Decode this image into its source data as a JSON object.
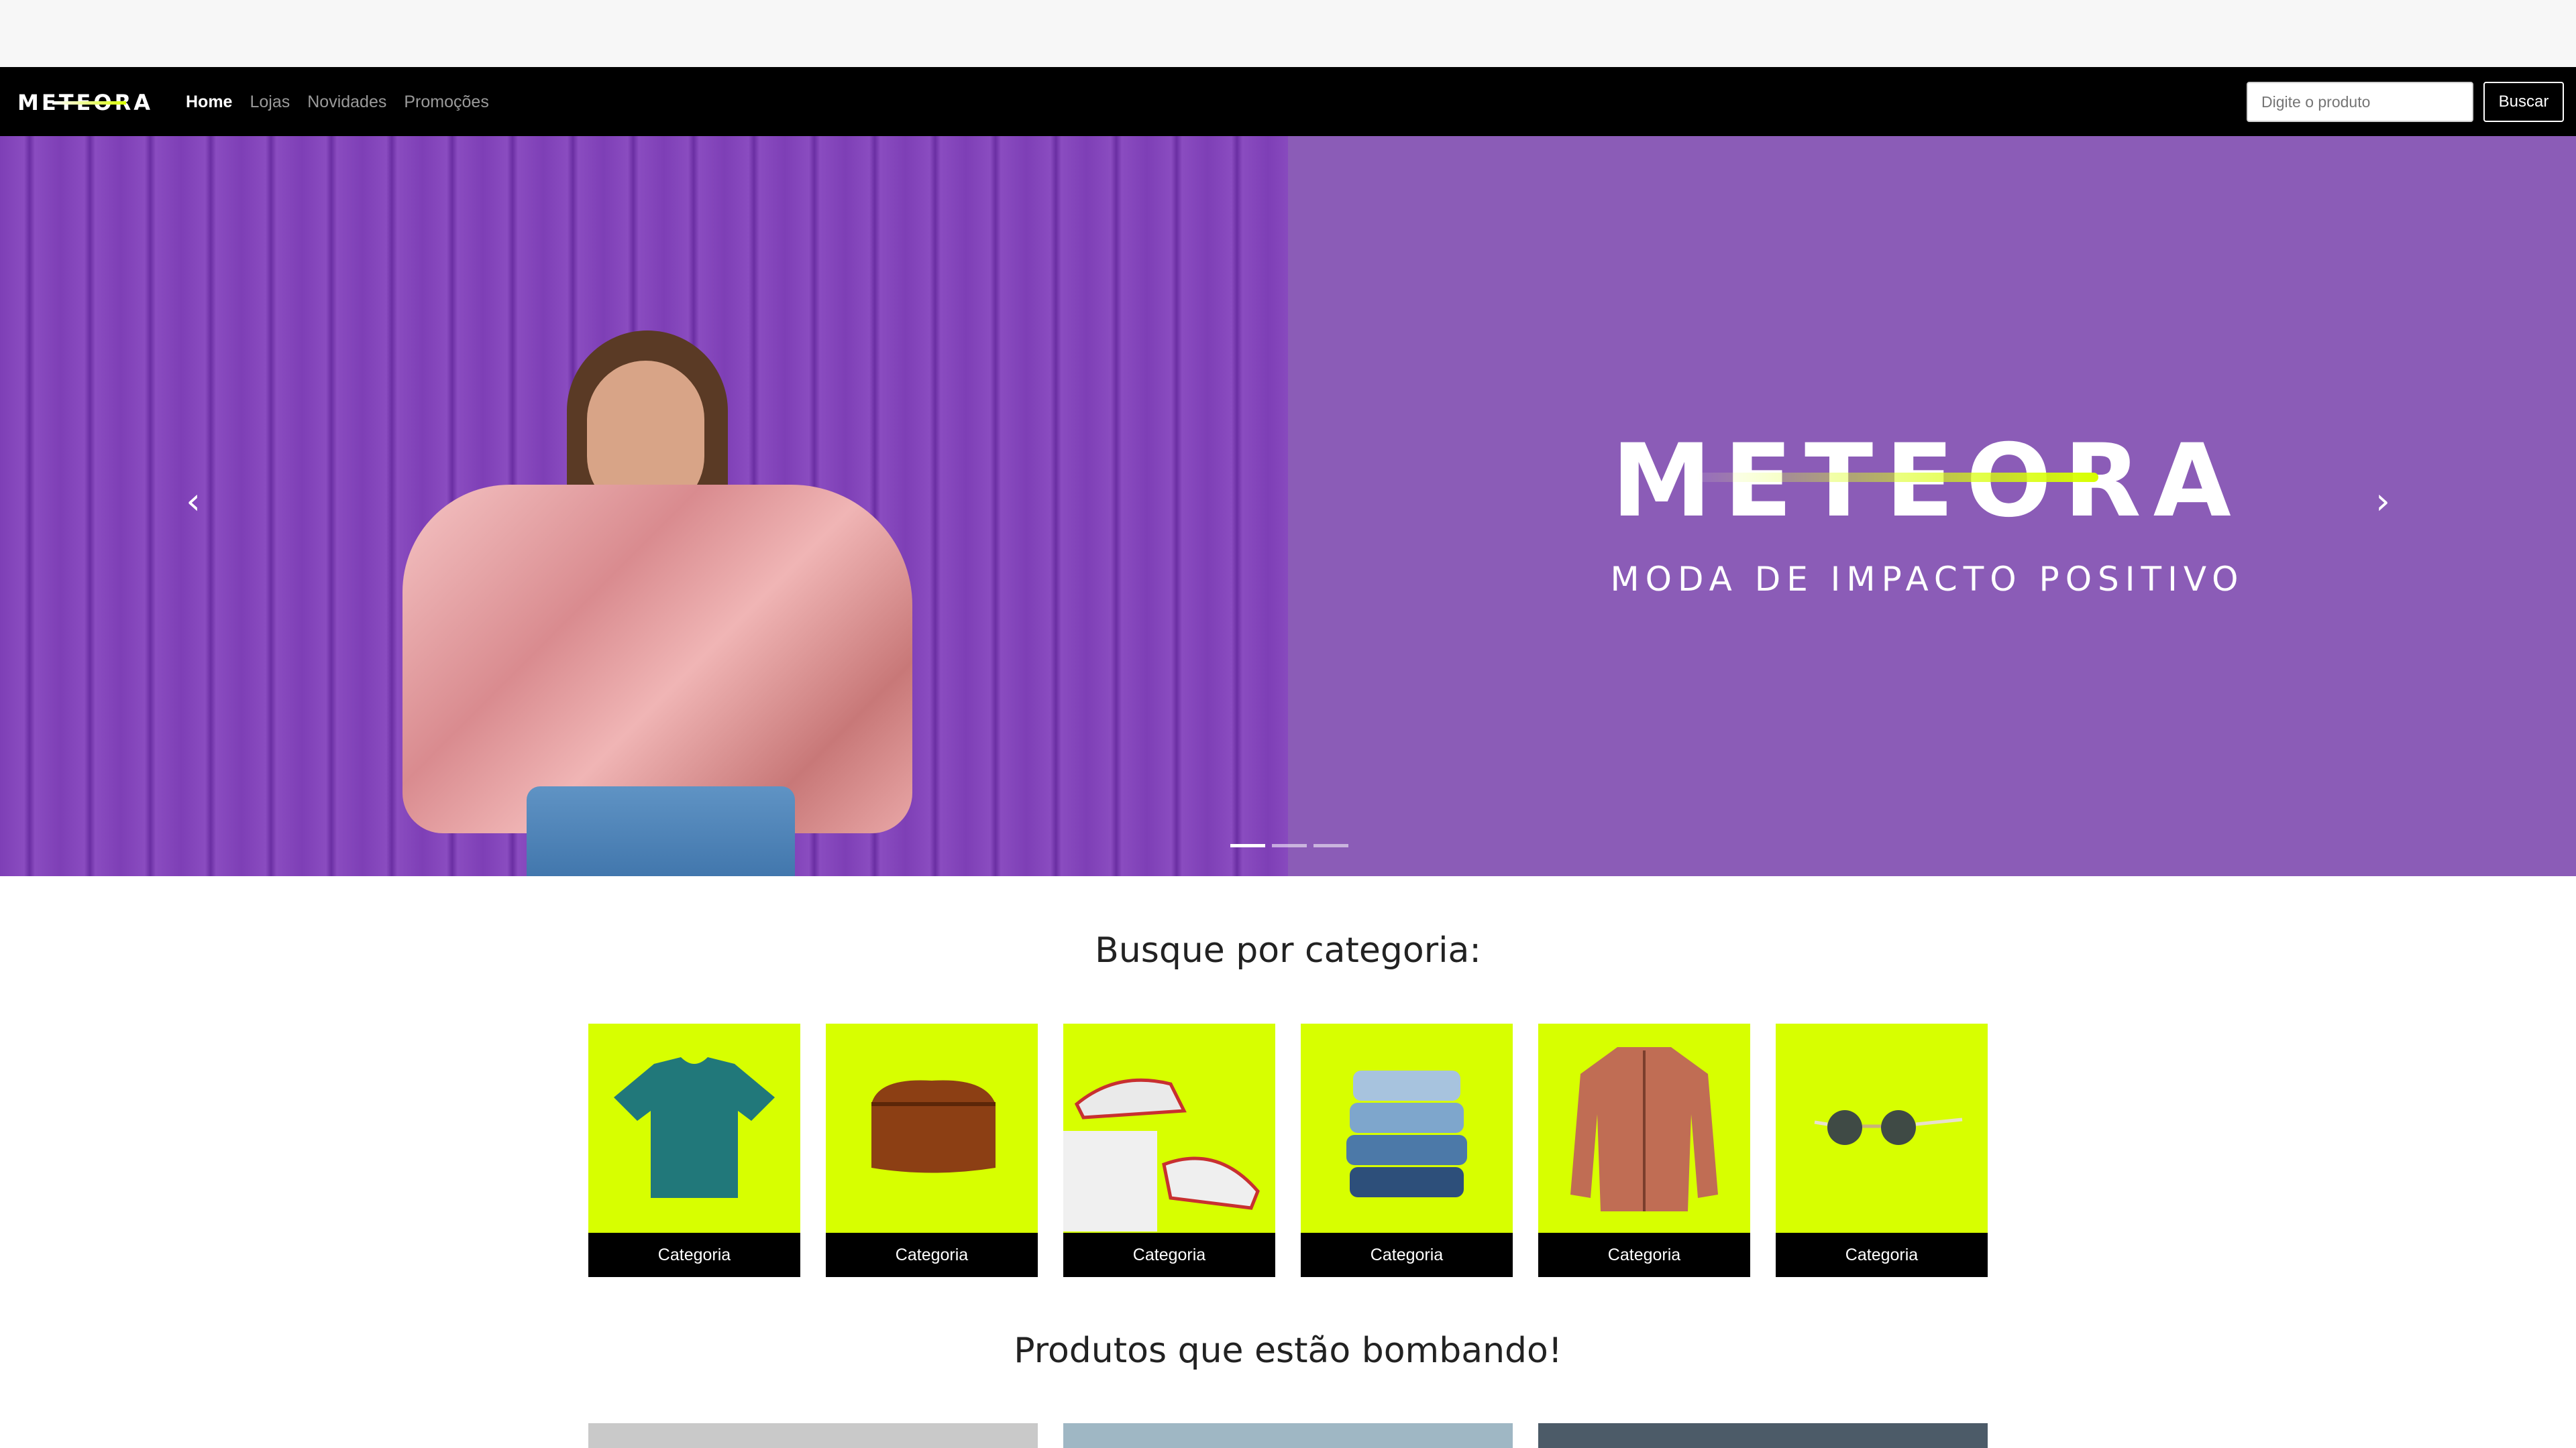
{
  "brand": {
    "name": "METEORA",
    "accent": "#d7ff00",
    "primary": "#000000",
    "hero_bg": "#8b5cb7"
  },
  "nav": {
    "links": [
      {
        "label": "Home",
        "active": true
      },
      {
        "label": "Lojas",
        "active": false
      },
      {
        "label": "Novidades",
        "active": false
      },
      {
        "label": "Promoções",
        "active": false
      }
    ]
  },
  "search": {
    "placeholder": "Digite o produto",
    "button_label": "Buscar"
  },
  "hero": {
    "title": "METEORA",
    "subtitle": "MODA DE IMPACTO POSITIVO",
    "prev_icon": "chevron-left-icon",
    "next_icon": "chevron-right-icon",
    "prev_glyph": "‹",
    "next_glyph": "›",
    "slides_count": 3,
    "active_slide": 1
  },
  "categories_section": {
    "title": "Busque por categoria:",
    "items": [
      {
        "label": "Categoria",
        "icon": "tshirt-icon"
      },
      {
        "label": "Categoria",
        "icon": "bag-icon"
      },
      {
        "label": "Categoria",
        "icon": "sneakers-icon"
      },
      {
        "label": "Categoria",
        "icon": "jeans-icon"
      },
      {
        "label": "Categoria",
        "icon": "jacket-icon"
      },
      {
        "label": "Categoria",
        "icon": "sunglasses-icon"
      }
    ]
  },
  "products_section": {
    "title": "Produtos que estão bombando!"
  }
}
